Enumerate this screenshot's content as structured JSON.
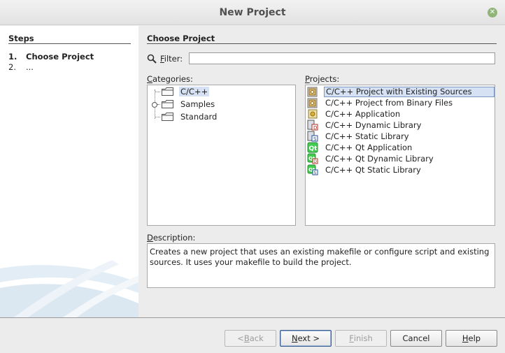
{
  "window": {
    "title": "New Project",
    "close_glyph": "✕"
  },
  "steps": {
    "header": "Steps",
    "items": [
      {
        "num": "1.",
        "label": "Choose Project"
      },
      {
        "num": "2.",
        "label": "..."
      }
    ]
  },
  "content": {
    "header": "Choose Project",
    "filter": {
      "label_mnemonic": "F",
      "label_rest": "ilter:",
      "value": ""
    },
    "categories_label": {
      "mnemonic": "C",
      "rest": "ategories:"
    },
    "categories": [
      {
        "label": "C/C++",
        "selected": true
      },
      {
        "label": "Samples",
        "expandable": true
      },
      {
        "label": "Standard"
      }
    ],
    "projects_label": {
      "mnemonic": "P",
      "rest": "rojects:"
    },
    "projects": [
      {
        "label": "C/C++ Project with Existing Sources",
        "icon": "project-existing-sources-icon",
        "selected": true
      },
      {
        "label": "C/C++ Project from Binary Files",
        "icon": "project-binary-files-icon"
      },
      {
        "label": "C/C++ Application",
        "icon": "application-icon"
      },
      {
        "label": "C/C++ Dynamic Library",
        "icon": "dynamic-library-icon"
      },
      {
        "label": "C/C++ Static Library",
        "icon": "static-library-icon"
      },
      {
        "label": "C/C++ Qt Application",
        "icon": "qt-application-icon"
      },
      {
        "label": "C/C++ Qt Dynamic Library",
        "icon": "qt-dynamic-library-icon"
      },
      {
        "label": "C/C++ Qt Static Library",
        "icon": "qt-static-library-icon"
      }
    ],
    "description_label": {
      "mnemonic": "D",
      "rest": "escription:"
    },
    "description": "Creates a new project that uses an existing makefile or configure script and existing sources. It uses your makefile to build the project."
  },
  "buttons": {
    "back": {
      "prefix": "< ",
      "mnemonic": "B",
      "rest": "ack"
    },
    "next": {
      "mnemonic": "N",
      "rest": "ext >"
    },
    "finish": {
      "mnemonic": "F",
      "rest": "inish"
    },
    "cancel": {
      "label": "Cancel"
    },
    "help": {
      "mnemonic": "H",
      "rest": "elp"
    }
  },
  "colors": {
    "selection": "#d6e2f3",
    "qt_green": "#41cd52",
    "folder": "#5a5a5a"
  }
}
